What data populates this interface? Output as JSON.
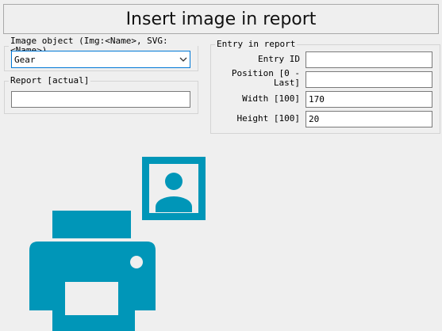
{
  "dialog": {
    "title": "Insert image in report"
  },
  "image_object": {
    "legend": "Image object (Img:<Name>, SVG:<Name>)",
    "selected": "Gear"
  },
  "report": {
    "legend": "Report [actual]",
    "value": ""
  },
  "entry": {
    "legend": "Entry in report",
    "entry_id_label": "Entry ID",
    "entry_id_value": "",
    "position_label": "Position [0 -\nLast]",
    "position_value": "",
    "width_label": "Width [100]",
    "width_value": "170",
    "height_label": "Height [100]",
    "height_value": "20"
  },
  "illustration": {
    "icon": "printer-with-user-image-icon",
    "color": "#0096b8"
  }
}
